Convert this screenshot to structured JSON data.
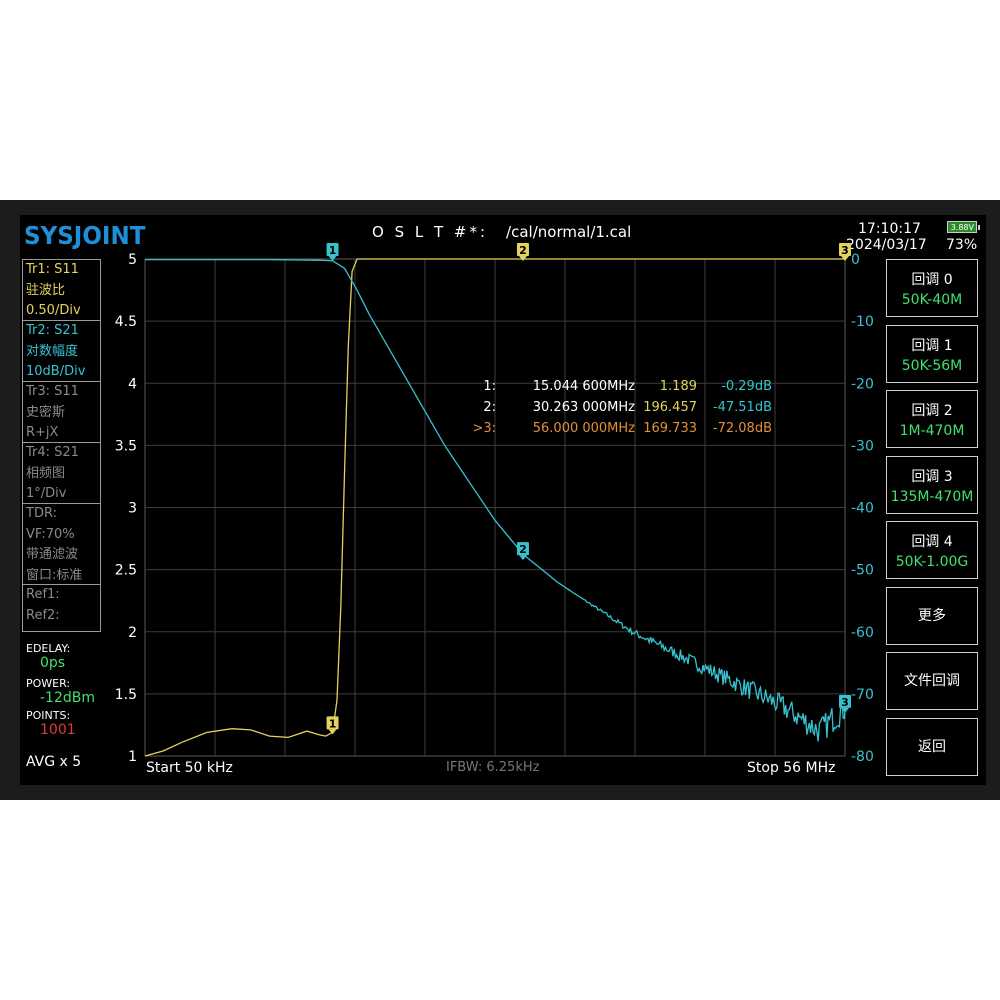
{
  "header": {
    "logo": "SYSJOINT",
    "cal_prefix": "O S L T #*:",
    "cal_path": "/cal/normal/1.cal",
    "time": "17:10:17",
    "date": "2024/03/17",
    "battery_voltage": "3.88V",
    "battery_percent": "73%"
  },
  "traces": [
    {
      "line1": "Tr1:   S11",
      "line2": "驻波比",
      "line3": "0.50/Div",
      "color": "#e3d35c",
      "active": true
    },
    {
      "line1": "Tr2:   S21",
      "line2": "对数幅度",
      "line3": "10dB/Div",
      "color": "#36c3d0",
      "active": true
    },
    {
      "line1": "Tr3:   S11",
      "line2": "史密斯",
      "line3": "R+jX",
      "color": "#8a8a8a",
      "active": false
    },
    {
      "line1": "Tr4:   S21",
      "line2": "相频图",
      "line3": "1°/Div",
      "color": "#8a8a8a",
      "active": false
    }
  ],
  "tdr": {
    "line1": "TDR:",
    "line2": "VF:70%",
    "line3": "带通滤波",
    "line4": "窗口:标准"
  },
  "ref": {
    "line1": "Ref1:",
    "line2": "Ref2:"
  },
  "settings": {
    "edelay_label": "EDELAY:",
    "edelay_value": "0ps",
    "power_label": "POWER:",
    "power_value": "-12dBm",
    "points_label": "POINTS:",
    "points_value": "1001",
    "avg": "AVG x 5"
  },
  "axes": {
    "left_ticks": [
      "5",
      "4.5",
      "4",
      "3.5",
      "3",
      "2.5",
      "2",
      "1.5",
      "1"
    ],
    "right_ticks": [
      "0",
      "-10",
      "-20",
      "-30",
      "-40",
      "-50",
      "-60",
      "-70",
      "-80"
    ],
    "start": "Start  50 kHz",
    "ifbw": "IFBW: 6.25kHz",
    "stop": "Stop  56 MHz"
  },
  "markers": [
    {
      "label": "1:",
      "freq": "15.044 600MHz",
      "swr": "1.189",
      "db": "-0.29dB",
      "color": "#ffffff"
    },
    {
      "label": "2:",
      "freq": "30.263 000MHz",
      "swr": "196.457",
      "db": "-47.51dB",
      "color": "#ffffff"
    },
    {
      "label": ">3:",
      "freq": "56.000 000MHz",
      "swr": "169.733",
      "db": "-72.08dB",
      "color": "#e0913a"
    }
  ],
  "marker_icons": [
    "1",
    "2",
    "3"
  ],
  "buttons": [
    {
      "title": "回调 0",
      "sub": "50K-40M"
    },
    {
      "title": "回调 1",
      "sub": "50K-56M"
    },
    {
      "title": "回调 2",
      "sub": "1M-470M"
    },
    {
      "title": "回调 3",
      "sub": "135M-470M"
    },
    {
      "title": "回调 4",
      "sub": "50K-1.00G"
    },
    {
      "title": "更多",
      "sub": ""
    },
    {
      "title": "文件回调",
      "sub": ""
    },
    {
      "title": "返回",
      "sub": ""
    }
  ],
  "chart_data": {
    "type": "line",
    "x_unit": "MHz",
    "xlim": [
      0.05,
      56
    ],
    "left_axis": {
      "ylim": [
        1,
        5
      ],
      "label": ""
    },
    "right_axis": {
      "ylim": [
        -80,
        0
      ],
      "label": ""
    },
    "grid": true,
    "series": [
      {
        "name": "Tr1: S11",
        "axis": "left",
        "color": "#e3d35c",
        "x": [
          0.05,
          1.5,
          3,
          5,
          7,
          8.5,
          10,
          11.5,
          13,
          14,
          14.5,
          15.04,
          15.4,
          15.7,
          16.0,
          16.3,
          16.6,
          17,
          18,
          20,
          25,
          30,
          35,
          40,
          45,
          50,
          56
        ],
        "y": [
          1.0,
          1.04,
          1.11,
          1.19,
          1.22,
          1.21,
          1.16,
          1.15,
          1.2,
          1.17,
          1.16,
          1.19,
          1.45,
          2.2,
          3.3,
          4.3,
          4.9,
          5.0,
          5.0,
          5.0,
          5.0,
          5.0,
          5.0,
          5.0,
          5.0,
          5.0,
          5.0
        ]
      },
      {
        "name": "Tr2: S21",
        "axis": "right",
        "color": "#36c3d0",
        "x": [
          0.05,
          10,
          14,
          15.04,
          16,
          17,
          18,
          20,
          22,
          24,
          26,
          28,
          30.26,
          33,
          36,
          39,
          42,
          45,
          48,
          51,
          54,
          56
        ],
        "y": [
          -0.1,
          -0.1,
          -0.2,
          -0.29,
          -1.5,
          -5,
          -9,
          -16,
          -23,
          -30,
          -36,
          -42,
          -47.5,
          -52,
          -56,
          -60,
          -63,
          -66,
          -69,
          -72,
          -76,
          -72.1
        ]
      }
    ]
  }
}
